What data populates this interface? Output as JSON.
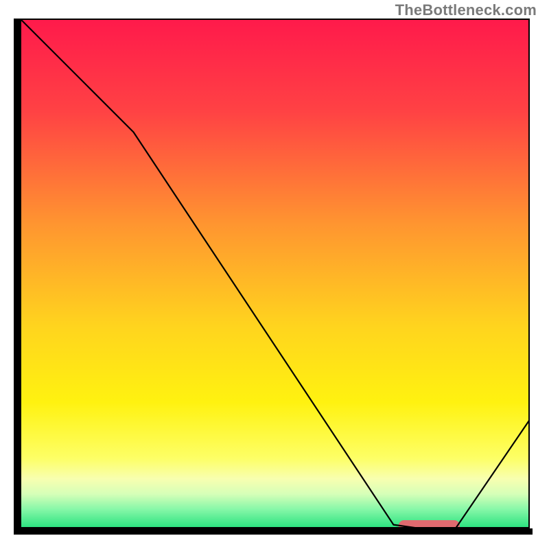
{
  "attribution": "TheBottleneck.com",
  "chart_data": {
    "type": "line",
    "title": "",
    "xlabel": "",
    "ylabel": "",
    "xlim": [
      0,
      100
    ],
    "ylim": [
      0,
      100
    ],
    "x": [
      0,
      22,
      73,
      80,
      85,
      100
    ],
    "values": [
      100,
      78,
      1,
      0,
      0,
      22
    ],
    "minimum_marker": {
      "x_start": 74,
      "x_end": 86,
      "y": 0
    },
    "background_gradient": [
      {
        "offset": 0.0,
        "color": "#ff1a4b"
      },
      {
        "offset": 0.18,
        "color": "#ff4244"
      },
      {
        "offset": 0.4,
        "color": "#ff9530"
      },
      {
        "offset": 0.6,
        "color": "#ffd41e"
      },
      {
        "offset": 0.75,
        "color": "#fff210"
      },
      {
        "offset": 0.86,
        "color": "#fdff66"
      },
      {
        "offset": 0.9,
        "color": "#f8ffb0"
      },
      {
        "offset": 0.93,
        "color": "#d6ffb8"
      },
      {
        "offset": 0.96,
        "color": "#86f7a8"
      },
      {
        "offset": 1.0,
        "color": "#1fe07a"
      }
    ]
  },
  "colors": {
    "axis": "#000000",
    "curve": "#000000",
    "marker": "#e06a6f",
    "attribution_text": "#7a7a7a"
  }
}
